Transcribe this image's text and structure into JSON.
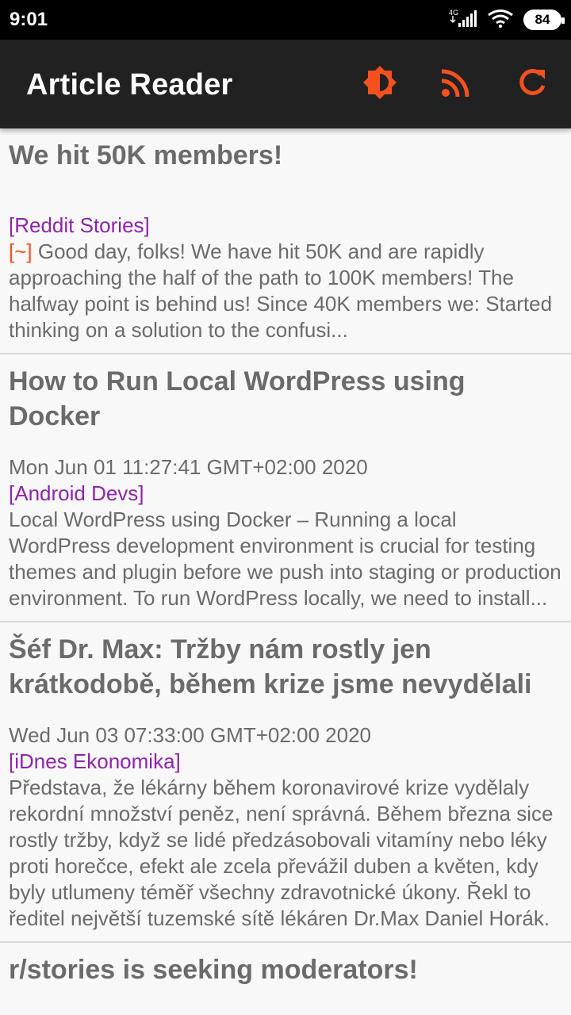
{
  "status_bar": {
    "time": "9:01",
    "network": "4G",
    "battery": "84"
  },
  "app_bar": {
    "title": "Article Reader",
    "actions": [
      "brightness-icon",
      "rss-icon",
      "refresh-icon"
    ],
    "accent_color": "#f4511e"
  },
  "articles": [
    {
      "title": "We hit 50K members!",
      "date": "",
      "source": "[Reddit Stories]",
      "marker": "[~]",
      "body": " Good day, folks! We have hit 50K and are rapidly approaching the half of the path to 100K members! The halfway point is behind us! Since 40K members we: Started thinking on a solution to the confusi..."
    },
    {
      "title": "How to Run Local WordPress using Docker",
      "date": "Mon Jun 01 11:27:41 GMT+02:00 2020",
      "source": "[Android Devs]",
      "body": "Local WordPress using Docker – Running a local WordPress development environment is crucial for testing themes and plugin before we push into staging or production environment. To run WordPress locally, we need to install..."
    },
    {
      "title": "Šéf Dr. Max: Tržby nám rostly jen krátkodobě, během krize jsme nevydělali",
      "date": "Wed Jun 03 07:33:00 GMT+02:00 2020",
      "source": "[iDnes Ekonomika]",
      "body": "Představa, že lékárny během koronavirové krize vydělaly rekordní množství peněz, není správná. Během března sice rostly tržby, když se lidé předzásobovali vitamíny nebo léky proti horečce, efekt ale zcela převážil duben a květen, kdy byly utlumeny téměř všechny zdravotnické úkony. Řekl to ředitel největší tuzemské sítě lékáren Dr.Max Daniel Horák."
    },
    {
      "title": "r/stories is seeking moderators!"
    }
  ]
}
